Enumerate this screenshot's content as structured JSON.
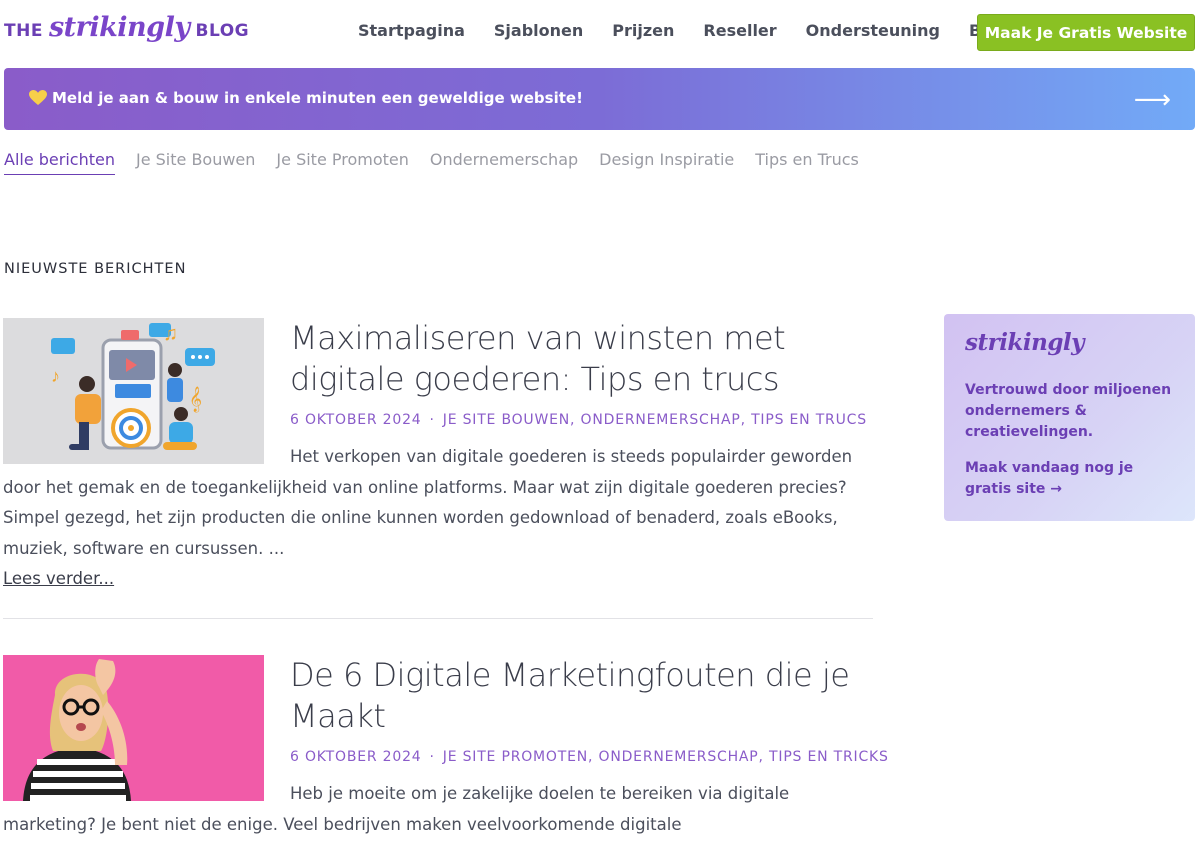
{
  "header": {
    "logo_prefix": "THE",
    "logo_brand": "strikingly",
    "logo_suffix": "BLOG",
    "nav": [
      "Startpagina",
      "Sjablonen",
      "Prijzen",
      "Reseller",
      "Ondersteuning",
      "Blog"
    ],
    "cta_label": "Maak Je Gratis Website",
    "accent_color": "#8ac123",
    "brand_color": "#6b3fb4"
  },
  "banner": {
    "text": "Meld je aan & bouw in enkele minuten een geweldige website!",
    "icon": "yellow-heart-icon",
    "arrow_icon": "arrow-right-icon"
  },
  "tabs": [
    "Alle berichten",
    "Je Site Bouwen",
    "Je Site Promoten",
    "Ondernemerschap",
    "Design Inspiratie",
    "Tips en Trucs"
  ],
  "section_label": "NIEUWSTE BERICHTEN",
  "posts": [
    {
      "title": "Maximaliseren van winsten met digitale goederen: Tips en trucs",
      "date": "6 OKTOBER 2024",
      "categories": "JE SITE BOUWEN, ONDERNEMERSCHAP, TIPS EN TRUCS",
      "excerpt": "Het verkopen van digitale goederen is steeds populairder geworden door het gemak en de toegankelijkheid van online platforms. Maar wat zijn digitale goederen precies? Simpel gezegd, het zijn producten die online kunnen worden gedownload of benaderd, zoals eBooks, muziek, software en cursussen. ...",
      "read_more": "Lees verder..."
    },
    {
      "title": "De 6 Digitale Marketingfouten die je Maakt",
      "date": "6 OKTOBER 2024",
      "categories": "JE SITE PROMOTEN, ONDERNEMERSCHAP, TIPS EN TRICKS",
      "excerpt": "Heb je moeite om je zakelijke doelen te bereiken via digitale marketing? Je bent niet de enige. Veel bedrijven maken veelvoorkomende digitale"
    }
  ],
  "sidebar": {
    "logo": "strikingly",
    "text": "Vertrouwd door miljoenen ondernemers & creatievelingen.",
    "link": "Maak vandaag nog je gratis site →"
  }
}
